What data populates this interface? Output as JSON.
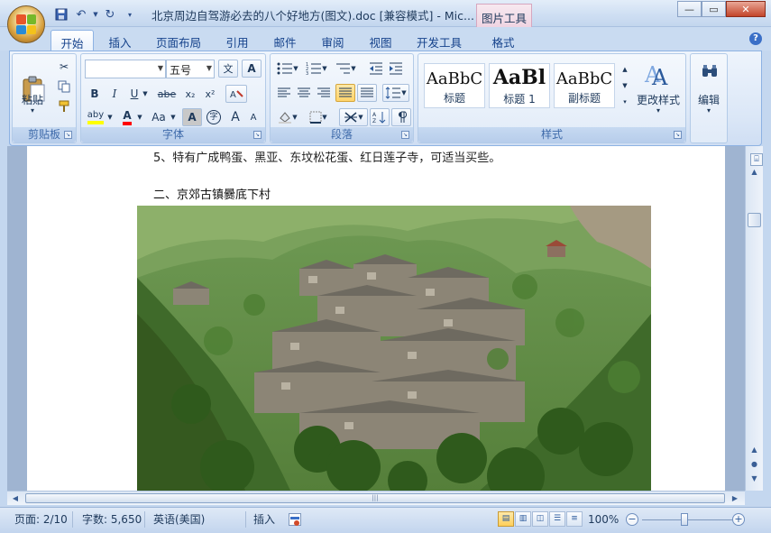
{
  "window": {
    "title": "北京周边自驾游必去的八个好地方(图文).doc [兼容模式] - Mic...",
    "context_tab": "图片工具"
  },
  "tabs": [
    "开始",
    "插入",
    "页面布局",
    "引用",
    "邮件",
    "审阅",
    "视图",
    "开发工具",
    "格式"
  ],
  "active_tab": "开始",
  "ribbon": {
    "clipboard": {
      "paste_label": "粘贴",
      "group_label": "剪贴板"
    },
    "font": {
      "font_name": "",
      "font_size": "五号",
      "group_label": "字体",
      "bold": "B",
      "italic": "I",
      "underline": "U",
      "strike": "abe",
      "subscript": "x₂",
      "superscript": "x²",
      "highlight": "aby",
      "font_color": "A",
      "change_case": "Aa",
      "char_shading": "A",
      "enclose": "字",
      "grow": "A",
      "shrink": "A",
      "phonetic": "文",
      "clear": "A"
    },
    "paragraph": {
      "group_label": "段落"
    },
    "styles": {
      "group_label": "样式",
      "items": [
        {
          "sample": "AaBbC",
          "name": "标题"
        },
        {
          "sample": "AaBl",
          "name": "标题 1"
        },
        {
          "sample": "AaBbC",
          "name": "副标题"
        }
      ],
      "change_styles_label": "更改样式"
    },
    "editing": {
      "label": "编辑"
    }
  },
  "document": {
    "line1": "5、特有广成鸭蛋、黑亚、东坟松花蛋、红日莲子寺，可适当买些。",
    "line2": "二、京郊古镇爨底下村"
  },
  "statusbar": {
    "page": "页面: 2/10",
    "words": "字数: 5,650",
    "language": "英语(美国)",
    "mode": "插入",
    "zoom": "100%",
    "zoom_level": 100
  },
  "colors": {
    "ribbon_bg": "#dbe7f7",
    "highlight_yellow": "#ffff00",
    "font_red": "#ff0000",
    "office_blue": "#15428b"
  }
}
